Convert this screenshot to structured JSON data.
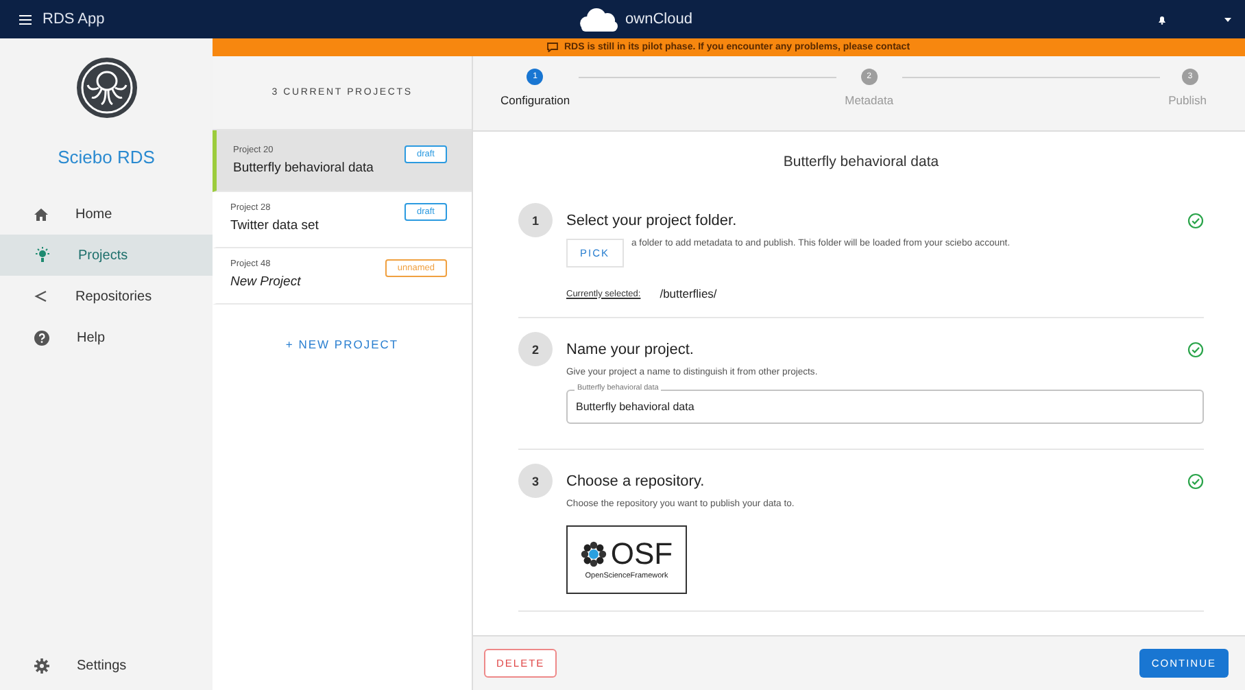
{
  "top_bar": {
    "app_title": "RDS App",
    "brand": "ownCloud"
  },
  "banner": {
    "text": "RDS is still in its pilot phase. If you encounter any problems, please contact"
  },
  "sidebar": {
    "title": "Sciebo RDS",
    "items": [
      {
        "label": "Home",
        "kind": "home",
        "selected": false
      },
      {
        "label": "Projects",
        "kind": "projects",
        "selected": true
      },
      {
        "label": "Repositories",
        "kind": "repositories",
        "selected": false
      },
      {
        "label": "Help",
        "kind": "help",
        "selected": false
      }
    ],
    "settings": {
      "label": "Settings"
    }
  },
  "projects": {
    "heading": "3 CURRENT PROJECTS",
    "items": [
      {
        "id_label": "Project 20",
        "name": "Butterfly behavioral data",
        "badge": "draft",
        "color": "#2b9ae0",
        "named": true,
        "selected": true
      },
      {
        "id_label": "Project 28",
        "name": "Twitter data set",
        "badge": "draft",
        "color": "#2b9ae0",
        "named": true,
        "selected": false
      },
      {
        "id_label": "Project 48",
        "name": "New Project",
        "badge": "unnamed",
        "color": "#f0a040",
        "named": false,
        "selected": false
      }
    ],
    "new_button": "+ NEW PROJECT"
  },
  "stepper": [
    {
      "number": "1",
      "label": "Configuration",
      "selected": true
    },
    {
      "number": "2",
      "label": "Metadata",
      "selected": false
    },
    {
      "number": "3",
      "label": "Publish",
      "selected": false
    }
  ],
  "form": {
    "title": "Butterfly behavioral data",
    "sections": [
      {
        "kind": "folder",
        "number": "1",
        "title": "Select your project folder.",
        "done": true,
        "button": "PICK",
        "description": "a folder to add metadata to and publish. This folder will be loaded from your sciebo account.",
        "selected_label": "Currently selected:",
        "selected_value": "/butterflies/"
      },
      {
        "kind": "name",
        "number": "2",
        "title": "Name your project.",
        "done": true,
        "description": "Give your project a name to distinguish it from other projects.",
        "field_label": "Butterfly behavioral data",
        "value": "Butterfly behavioral data"
      },
      {
        "kind": "repository",
        "number": "3",
        "title": "Choose a repository.",
        "done": true,
        "description": "Choose the repository you want to publish your data to.",
        "logo_text": "OSF",
        "logo_caption": "OpenScienceFramework"
      }
    ]
  },
  "footer": {
    "delete": "DELETE",
    "continue": "CONTINUE"
  }
}
